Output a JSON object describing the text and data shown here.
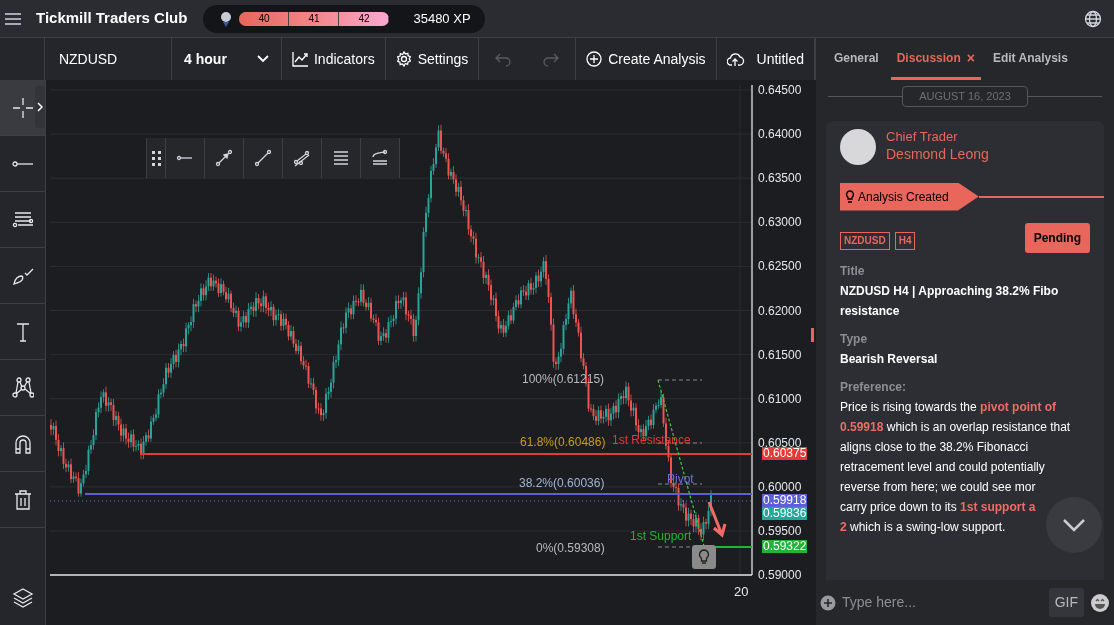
{
  "app": {
    "title": "Tickmill Traders Club",
    "levels": [
      "40",
      "41",
      "42"
    ],
    "level": 1,
    "xp": "35480 XP"
  },
  "toolbar": {
    "symbol": "NZDUSD",
    "timeframe": "4 hour",
    "buttons": [
      {
        "kind": "indicators",
        "label": "Indicators",
        "disabled": false
      },
      {
        "kind": "settings",
        "label": "Settings",
        "disabled": false
      },
      {
        "kind": "undo",
        "disabled": true
      },
      {
        "kind": "redo",
        "disabled": true
      },
      {
        "kind": "create",
        "label": "Create Analysis",
        "disabled": false
      },
      {
        "kind": "upload",
        "label": "Untitled",
        "disabled": false
      }
    ]
  },
  "drawing_tools": [
    {
      "kind": "crosshair",
      "selected": true
    },
    {
      "kind": "line",
      "selected": false
    },
    {
      "kind": "levels",
      "selected": false
    },
    {
      "kind": "brush",
      "selected": false
    },
    {
      "kind": "text",
      "selected": false
    },
    {
      "kind": "pattern",
      "selected": false
    },
    {
      "kind": "magnet",
      "selected": false
    },
    {
      "kind": "trash",
      "selected": false
    },
    {
      "kind": "layers",
      "selected": false
    }
  ],
  "line_tools": [
    {
      "kind": "drag"
    },
    {
      "kind": "ray"
    },
    {
      "kind": "arrow"
    },
    {
      "kind": "segment"
    },
    {
      "kind": "parallel"
    },
    {
      "kind": "fib"
    },
    {
      "kind": "curve"
    }
  ],
  "chart": {
    "price_labels": [
      "0.64500",
      "0.64000",
      "0.63500",
      "0.63000",
      "0.62500",
      "0.62000",
      "0.61500",
      "0.61000",
      "0.60500",
      "0.60000",
      "0.59500",
      "0.59000"
    ],
    "time_labels": [
      "20"
    ],
    "markers": [
      {
        "text": "0.60375",
        "color": "#e53935"
      },
      {
        "text": "0.59918",
        "color": "#5c5fd6"
      },
      {
        "text": "0.59836",
        "color": "#26a69a"
      },
      {
        "text": "0.59322",
        "color": "#22b33a"
      }
    ],
    "annotations": [
      {
        "kind": "fib",
        "text": "100%(0.61215)"
      },
      {
        "kind": "fib_gold",
        "text": "61.8%(0.60486)"
      },
      {
        "kind": "resistance",
        "text": "1st Resistance"
      },
      {
        "kind": "fib_blue",
        "text": "38.2%(0.60036)"
      },
      {
        "kind": "pivot",
        "text": "Pivot"
      },
      {
        "kind": "support",
        "text": "1st Support"
      },
      {
        "kind": "fib",
        "text": "0%(0.59308)"
      }
    ]
  },
  "panel": {
    "tabs": [
      {
        "label": "General",
        "selected": false
      },
      {
        "label": "Discussion",
        "selected": true,
        "close": "×"
      },
      {
        "label": "Edit Analysis",
        "selected": false
      }
    ],
    "date": "AUGUST 16, 2023",
    "post": {
      "role": "Chief Trader",
      "author": "Desmond Leong",
      "event": "Analysis Created",
      "tags": [
        "NZDUSD",
        "H4"
      ],
      "status": "Pending",
      "fields": [
        {
          "label": "Title",
          "value": "NZDUSD H4 | Approaching 38.2% Fibo resistance"
        },
        {
          "label": "Type",
          "value": "Bearish Reversal"
        },
        {
          "label": "Preference:",
          "value": "Price is rising towards the **pivot point of 0.59918** which is an overlap resistance that aligns close to the 38.2% Fibonacci retracement level and could potentially reverse from here; we could see mor"
        },
        {
          "kind": "continuation",
          "value": "carry price down to its **1st support a** **2** which is a swing-low support."
        }
      ]
    },
    "composer": {
      "placeholder": "Type here...",
      "gif": "GIF"
    }
  }
}
